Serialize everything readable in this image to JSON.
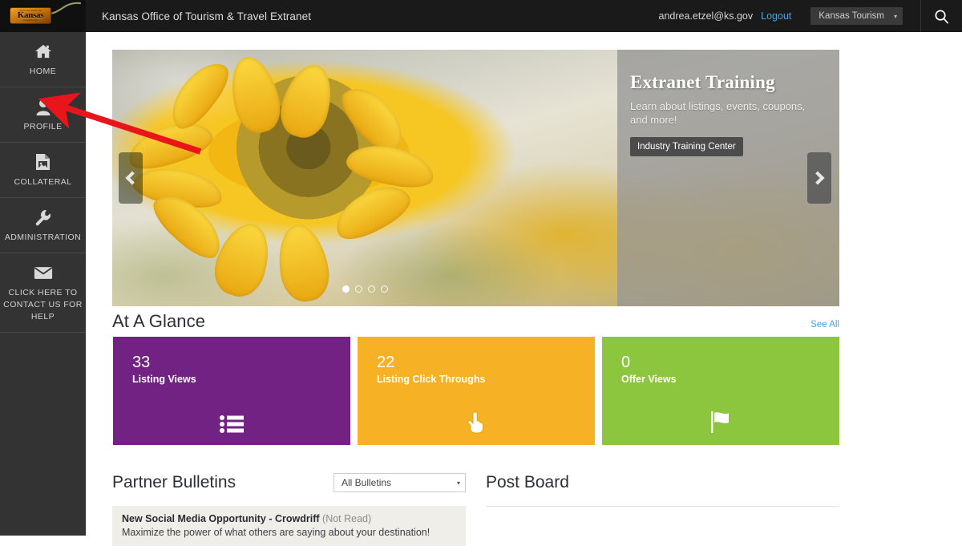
{
  "topbar": {
    "logo_word": "Kansas",
    "logo_tagline_top": "There's No Place Like",
    "logo_tagline_bottom": "TravelKS.com",
    "title": "Kansas Office of Tourism & Travel Extranet",
    "user_email": "andrea.etzel@ks.gov",
    "logout_label": "Logout",
    "org_selected": "Kansas Tourism",
    "caret": "▾",
    "search_icon": "search-icon"
  },
  "sidebar": {
    "items": [
      {
        "label": "HOME",
        "icon": "home-icon"
      },
      {
        "label": "PROFILE",
        "icon": "user-icon"
      },
      {
        "label": "COLLATERAL",
        "icon": "image-document-icon"
      },
      {
        "label": "ADMINISTRATION",
        "icon": "wrench-icon"
      },
      {
        "label": "CLICK HERE TO CONTACT US FOR HELP",
        "icon": "envelope-icon"
      }
    ]
  },
  "hero": {
    "panel_title": "Extranet Training",
    "panel_subtitle": "Learn about listings, events, coupons, and more!",
    "panel_button": "Industry Training Center",
    "prev_label": "‹",
    "next_label": "›",
    "slide_count": 4,
    "active_slide": 1
  },
  "at_a_glance": {
    "title": "At A Glance",
    "see_all": "See All",
    "cards": [
      {
        "value": "33",
        "label": "Listing Views",
        "color": "#722282",
        "icon": "list-icon"
      },
      {
        "value": "22",
        "label": "Listing Click Throughs",
        "color": "#f7b124",
        "icon": "pointing-hand-icon"
      },
      {
        "value": "0",
        "label": "Offer Views",
        "color": "#8cc63e",
        "icon": "flag-icon"
      }
    ]
  },
  "partner_bulletins": {
    "title": "Partner Bulletins",
    "filter_value": "All Bulletins",
    "caret": "▾",
    "items": [
      {
        "title": "New Social Media Opportunity - Crowdriff",
        "state": "(Not Read)",
        "description": "Maximize the power of what others are saying about your destination!"
      }
    ]
  },
  "post_board": {
    "title": "Post Board"
  },
  "annotation": {
    "type": "red-arrow",
    "points_to": "PROFILE",
    "color": "#e8161a"
  }
}
